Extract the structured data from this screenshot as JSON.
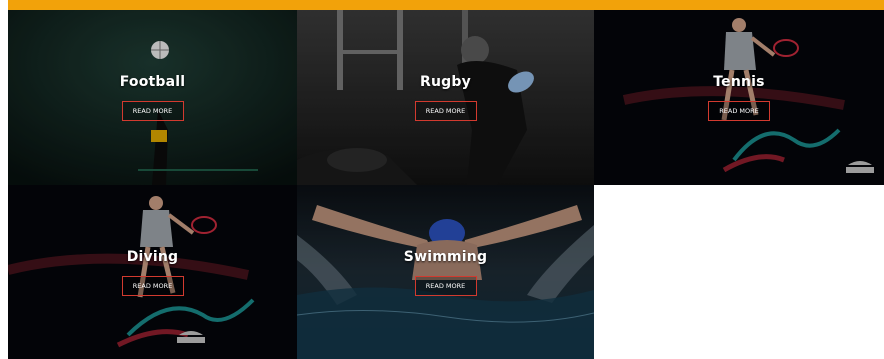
{
  "accent": {
    "top_bar": "#f2a20a",
    "button_border": "#d23a2f"
  },
  "tiles": [
    {
      "title": "Football",
      "button": "READ MORE"
    },
    {
      "title": "Rugby",
      "button": "READ MORE"
    },
    {
      "title": "Tennis",
      "button": "READ MORE"
    },
    {
      "title": "Diving",
      "button": "READ MORE"
    },
    {
      "title": "Swimming",
      "button": "READ MORE"
    }
  ]
}
